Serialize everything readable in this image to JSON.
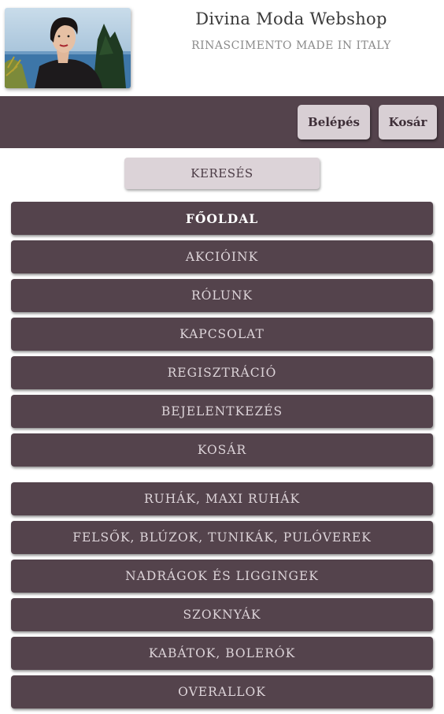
{
  "header": {
    "title": "Divina Moda Webshop",
    "subtitle": "RINASCIMENTO MADE IN ITALY"
  },
  "topbar": {
    "login_label": "Belépés",
    "cart_label": "Kosár"
  },
  "search": {
    "label": "KERESÉS"
  },
  "main_menu": [
    {
      "label": "FŐOLDAL",
      "active": true
    },
    {
      "label": "AKCIÓINK"
    },
    {
      "label": "RÓLUNK"
    },
    {
      "label": "KAPCSOLAT"
    },
    {
      "label": "REGISZTRÁCIÓ"
    },
    {
      "label": "BEJELENTKEZÉS"
    },
    {
      "label": "KOSÁR"
    }
  ],
  "category_menu": [
    {
      "label": "RUHÁK, MAXI RUHÁK"
    },
    {
      "label": "FELSŐK, BLÚZOK, TUNIKÁK, PULÓVEREK"
    },
    {
      "label": "NADRÁGOK ÉS LIGGINGEK"
    },
    {
      "label": "SZOKNYÁK"
    },
    {
      "label": "KABÁTOK, BOLERÓK"
    },
    {
      "label": "OVERALLOK"
    }
  ],
  "colors": {
    "bar": "#54434c",
    "button_light": "#d8cfd4"
  }
}
